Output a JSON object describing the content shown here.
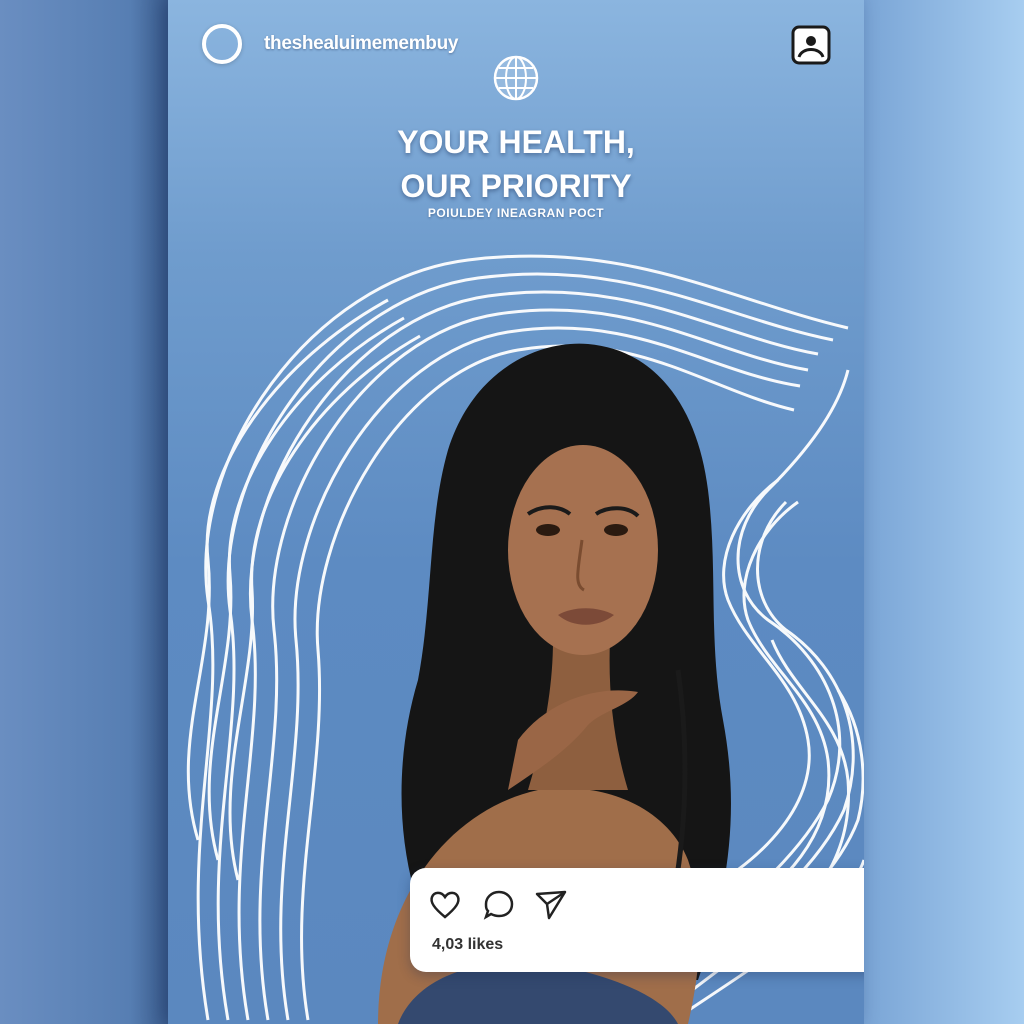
{
  "post": {
    "username": "theshealuimemembuy",
    "headline_line1": "YOUR HEALTH,",
    "headline_line2": "OUR PRIORITY",
    "subheadline": "POIULDEY INEAGRAN POCT",
    "likes_text": "4,03 likes"
  },
  "icons": {
    "avatar": "avatar-ring-icon",
    "account": "account-frame-icon",
    "globe": "globe-icon",
    "like": "heart-icon",
    "comment": "comment-bubble-icon",
    "share": "send-icon",
    "save": "bookmark-icon"
  },
  "colors": {
    "card_top": "#8bb5df",
    "card_bottom": "#5b88bf",
    "wave_lines": "#ffffff",
    "action_bar": "#ffffff",
    "hair": "#151515",
    "skin": "#9a6a48"
  }
}
